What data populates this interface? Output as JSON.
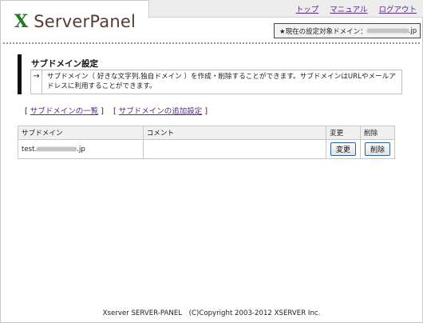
{
  "header": {
    "logo_mark": "X",
    "logo_text": "ServerPanel",
    "nav": [
      "トップ",
      "マニュアル",
      "ログアウト"
    ],
    "domain_label": "★現在の設定対象ドメイン：",
    "domain_suffix": ".jp"
  },
  "section": {
    "title": "サブドメイン設定",
    "arrow": "→",
    "description": "サブドメイン（ 好きな文字列.独自ドメイン ）を作成・削除することができます。サブドメインはURLやメールアドレスに利用することができます。"
  },
  "links": [
    {
      "bracket_open": "[",
      "label": "サブドメインの一覧",
      "bracket_close": "]"
    },
    {
      "bracket_open": "[",
      "label": "サブドメインの追加設定",
      "bracket_close": "]"
    }
  ],
  "table": {
    "headers": [
      "サブドメイン",
      "コメント",
      "変更",
      "削除"
    ],
    "rows": [
      {
        "subdomain_prefix": "test.",
        "subdomain_suffix": ".jp",
        "comment": "",
        "change_label": "変更",
        "delete_label": "削除"
      }
    ]
  },
  "footer": {
    "text": "Xserver SERVER-PANEL　(C)Copyright 2003-2012 XSERVER Inc."
  }
}
